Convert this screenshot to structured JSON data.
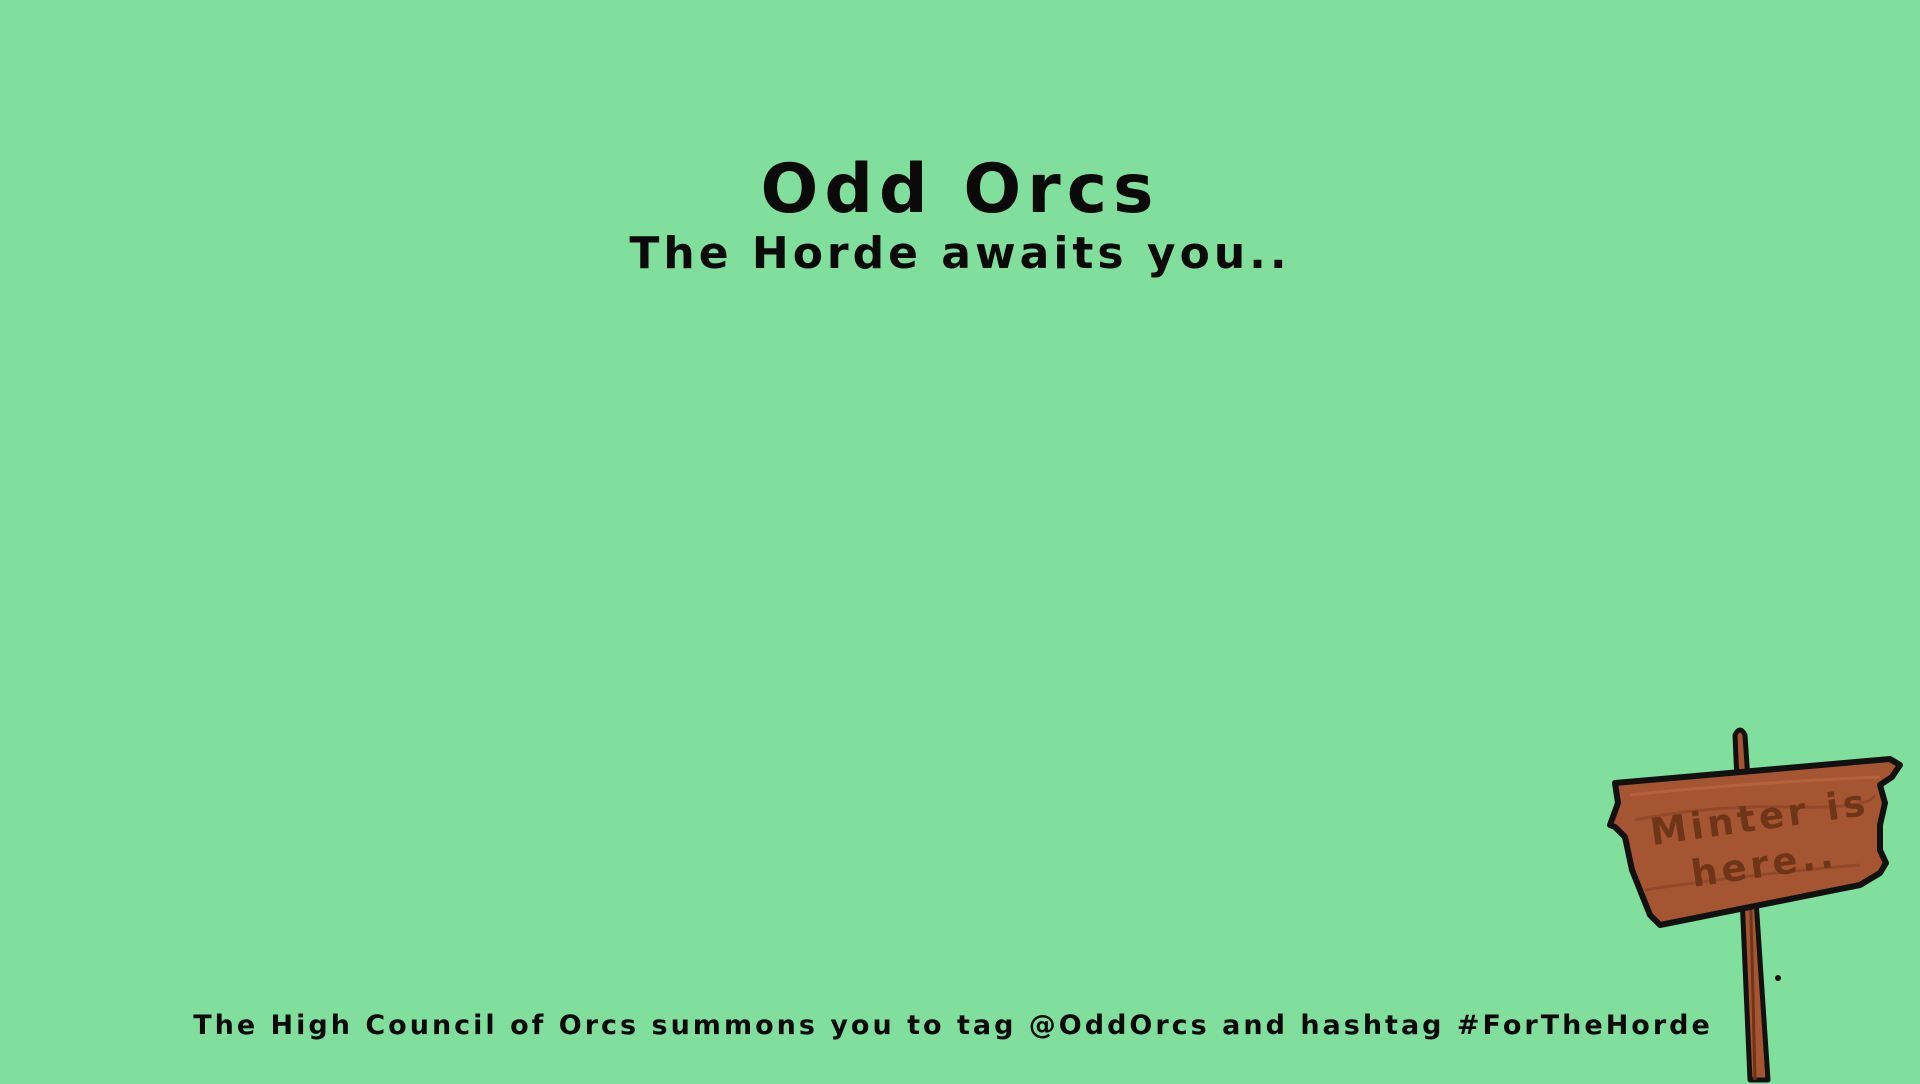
{
  "page": {
    "title": "Odd Orcs",
    "subtitle": "The Horde awaits you..",
    "footer_text": "The High Council of Orcs summons you to tag @OddOrcs and hashtag #ForTheHorde"
  },
  "sign": {
    "line1": "Minter is",
    "line2": "here.."
  },
  "colors": {
    "background": "#80df9c",
    "text": "#0a0a0a",
    "wood": "#a65533",
    "wood_dark": "#6e3519"
  }
}
